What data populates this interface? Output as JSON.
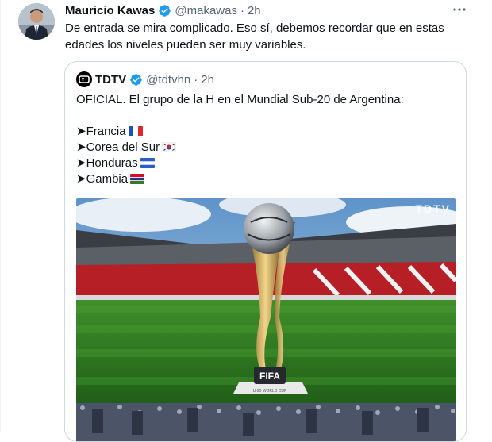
{
  "tweet": {
    "author_name": "Mauricio Kawas",
    "handle": "@makawas",
    "separator": "·",
    "time": "2h",
    "text_line1": "De entrada se mira complicado. Eso sí, debemos recordar que en estas",
    "text_line2": "edades los niveles pueden ser muy variables.",
    "more_icon": "more-horizontal-icon"
  },
  "quote": {
    "author_name": "TDTV",
    "handle": "@tdtvhn",
    "separator": "·",
    "time": "2h",
    "line1": "OFICIAL. El grupo de la H en el Mundial Sub-20 de Argentina:",
    "teams": [
      {
        "label": "➤Francia",
        "flag": "france-flag"
      },
      {
        "label": "➤Corea del Sur",
        "flag": "south-korea-flag"
      },
      {
        "label": "➤Honduras",
        "flag": "honduras-flag"
      },
      {
        "label": "➤Gambia",
        "flag": "gambia-flag"
      }
    ],
    "media": {
      "watermark": "TDTV",
      "trophy_text": "FIFA",
      "trophy_subtext": "U-20 WORLD CUP"
    }
  },
  "colors": {
    "verified_blue": "#1d9bf0",
    "muted_text": "#536471",
    "border": "#cfd9de"
  }
}
